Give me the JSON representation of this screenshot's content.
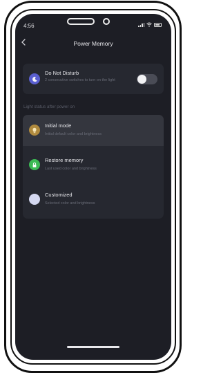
{
  "status_bar": {
    "time": "4:56"
  },
  "header": {
    "title": "Power Memory",
    "back_icon": "chevron-left-icon"
  },
  "dnd": {
    "title": "Do Not Disturb",
    "subtitle": "2 consecutive switches to turn on the light",
    "enabled": false,
    "icon": "moon-icon",
    "icon_color": "#5a5fd0"
  },
  "section_label": "Light status after power on",
  "modes": [
    {
      "title": "Initial mode",
      "subtitle": "Initial default color and brightness",
      "selected": true,
      "icon": "bulb-icon",
      "color": "#b08a3e"
    },
    {
      "title": "Restore memory",
      "subtitle": "Last used color and brightness",
      "selected": false,
      "icon": "lock-icon",
      "color": "#3cba54"
    },
    {
      "title": "Customized",
      "subtitle": "Selected color and brightness",
      "selected": false,
      "icon": "color-dot-icon",
      "color": "#d4d8f0"
    }
  ],
  "colors": {
    "background": "#1d1e25",
    "card": "#262830",
    "selected_row": "#34363e"
  }
}
